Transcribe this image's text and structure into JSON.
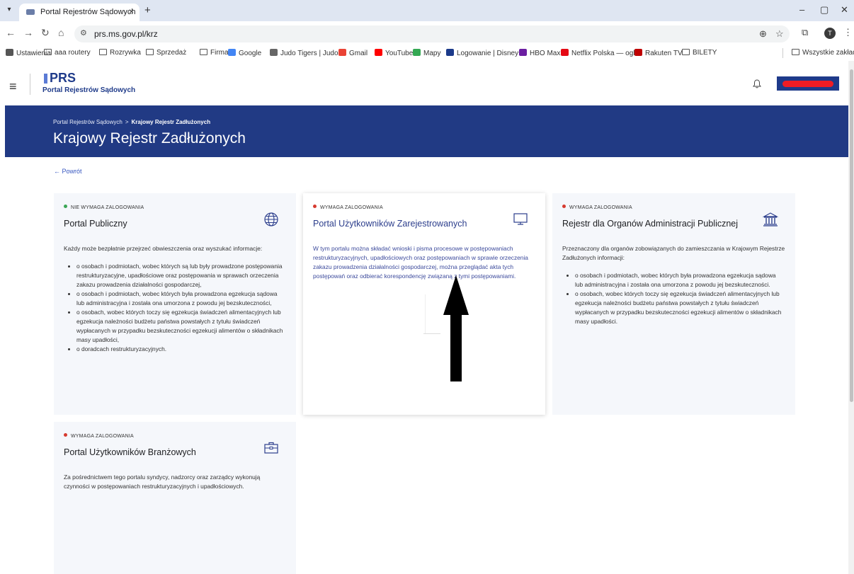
{
  "browser": {
    "tab_title": "Portal Rejestrów Sądowych",
    "close_glyph": "×",
    "new_tab_glyph": "+",
    "url": "prs.ms.gov.pl/krz",
    "profile_initial": "T",
    "bookmarks": [
      {
        "label": "Ustawienia",
        "icon": "gear-icon"
      },
      {
        "label": "aaa routery",
        "icon": "folder-icon"
      },
      {
        "label": "Rozrywka",
        "icon": "folder-icon"
      },
      {
        "label": "Sprzedaż",
        "icon": "folder-icon"
      },
      {
        "label": "Firma",
        "icon": "folder-icon"
      },
      {
        "label": "Google",
        "icon": "google-icon"
      },
      {
        "label": "Judo Tigers | Judo...",
        "icon": "judo-icon"
      },
      {
        "label": "Gmail",
        "icon": "gmail-icon"
      },
      {
        "label": "YouTube",
        "icon": "youtube-icon"
      },
      {
        "label": "Mapy",
        "icon": "maps-icon"
      },
      {
        "label": "Logowanie | Disney+",
        "icon": "disney-icon"
      },
      {
        "label": "HBO Max",
        "icon": "hbo-icon"
      },
      {
        "label": "Netflix Polska — ogl...",
        "icon": "netflix-icon"
      },
      {
        "label": "Rakuten TV",
        "icon": "rakuten-icon"
      },
      {
        "label": "BILETY",
        "icon": "folder-icon"
      }
    ],
    "all_bookmarks": "Wszystkie zakładki"
  },
  "header": {
    "logo": "PRS",
    "logo_subtitle": "Portal Rejestrów Sądowych"
  },
  "banner": {
    "breadcrumb_home": "Portal Rejestrów Sądowych",
    "breadcrumb_sep": ">",
    "breadcrumb_current": "Krajowy Rejestr Zadłużonych",
    "title": "Krajowy Rejestr Zadłużonych"
  },
  "back_link": "Powrót",
  "colors": {
    "banner": "#213a84",
    "dot_green": "#3aa655",
    "dot_red": "#d63a2f",
    "accent": "#2c3e8c"
  },
  "cards": [
    {
      "badge": "NIE WYMAGA ZALOGOWANIA",
      "title": "Portal Publiczny",
      "icon": "globe-icon",
      "intro": "Każdy może bezpłatnie przejrzeć obwieszczenia oraz wyszukać informacje:",
      "items": [
        "o osobach i podmiotach, wobec których są lub były prowadzone postępowania restrukturyzacyjne, upadłościowe oraz postępowania w sprawach orzeczenia zakazu prowadzenia działalności gospodarczej,",
        "o osobach i podmiotach, wobec których była prowadzona egzekucja sądowa lub administracyjna i została ona umorzona z powodu jej bezskuteczności,",
        "o osobach, wobec których toczy się egzekucja świadczeń alimentacyjnych lub egzekucja należności budżetu państwa powstałych z tytułu świadczeń wypłacanych w przypadku bezskuteczności egzekucji alimentów o składnikach masy upadłości,",
        "o doradcach restrukturyzacyjnych."
      ]
    },
    {
      "badge": "WYMAGA ZALOGOWANIA",
      "title": "Portal Użytkowników Zarejestrowanych",
      "icon": "monitor-icon",
      "intro": "W tym portalu można składać wnioski i pisma procesowe w postępowaniach restrukturyzacyjnych, upadłościowych oraz postępowaniach w sprawie orzeczenia zakazu prowadzenia działalności gospodarczej, można przeglądać akta tych postępowań oraz odbierać korespondencję związaną z tymi postępowaniami.",
      "items": []
    },
    {
      "badge": "WYMAGA ZALOGOWANIA",
      "title": "Rejestr dla Organów Administracji Publicznej",
      "icon": "institution-icon",
      "intro": "Przeznaczony dla organów zobowiązanych do zamieszczania w Krajowym Rejestrze Zadłużonych informacji:",
      "items": [
        "o osobach i podmiotach, wobec których była prowadzona egzekucja sądowa lub administracyjna i została ona umorzona z powodu jej bezskuteczności.",
        "o osobach, wobec których toczy się egzekucja świadczeń alimentacyjnych lub egzekucja należności budżetu państwa powstałych z tytułu świadczeń wypłacanych w przypadku bezskuteczności egzekucji alimentów o składnikach masy upadłości."
      ]
    },
    {
      "badge": "WYMAGA ZALOGOWANIA",
      "title": "Portal Użytkowników Branżowych",
      "icon": "briefcase-icon",
      "intro": "Za pośrednictwem tego portalu syndycy, nadzorcy oraz zarządcy wykonują czynności w postępowaniach restrukturyzacyjnych i upadłościowych.",
      "items": []
    }
  ]
}
